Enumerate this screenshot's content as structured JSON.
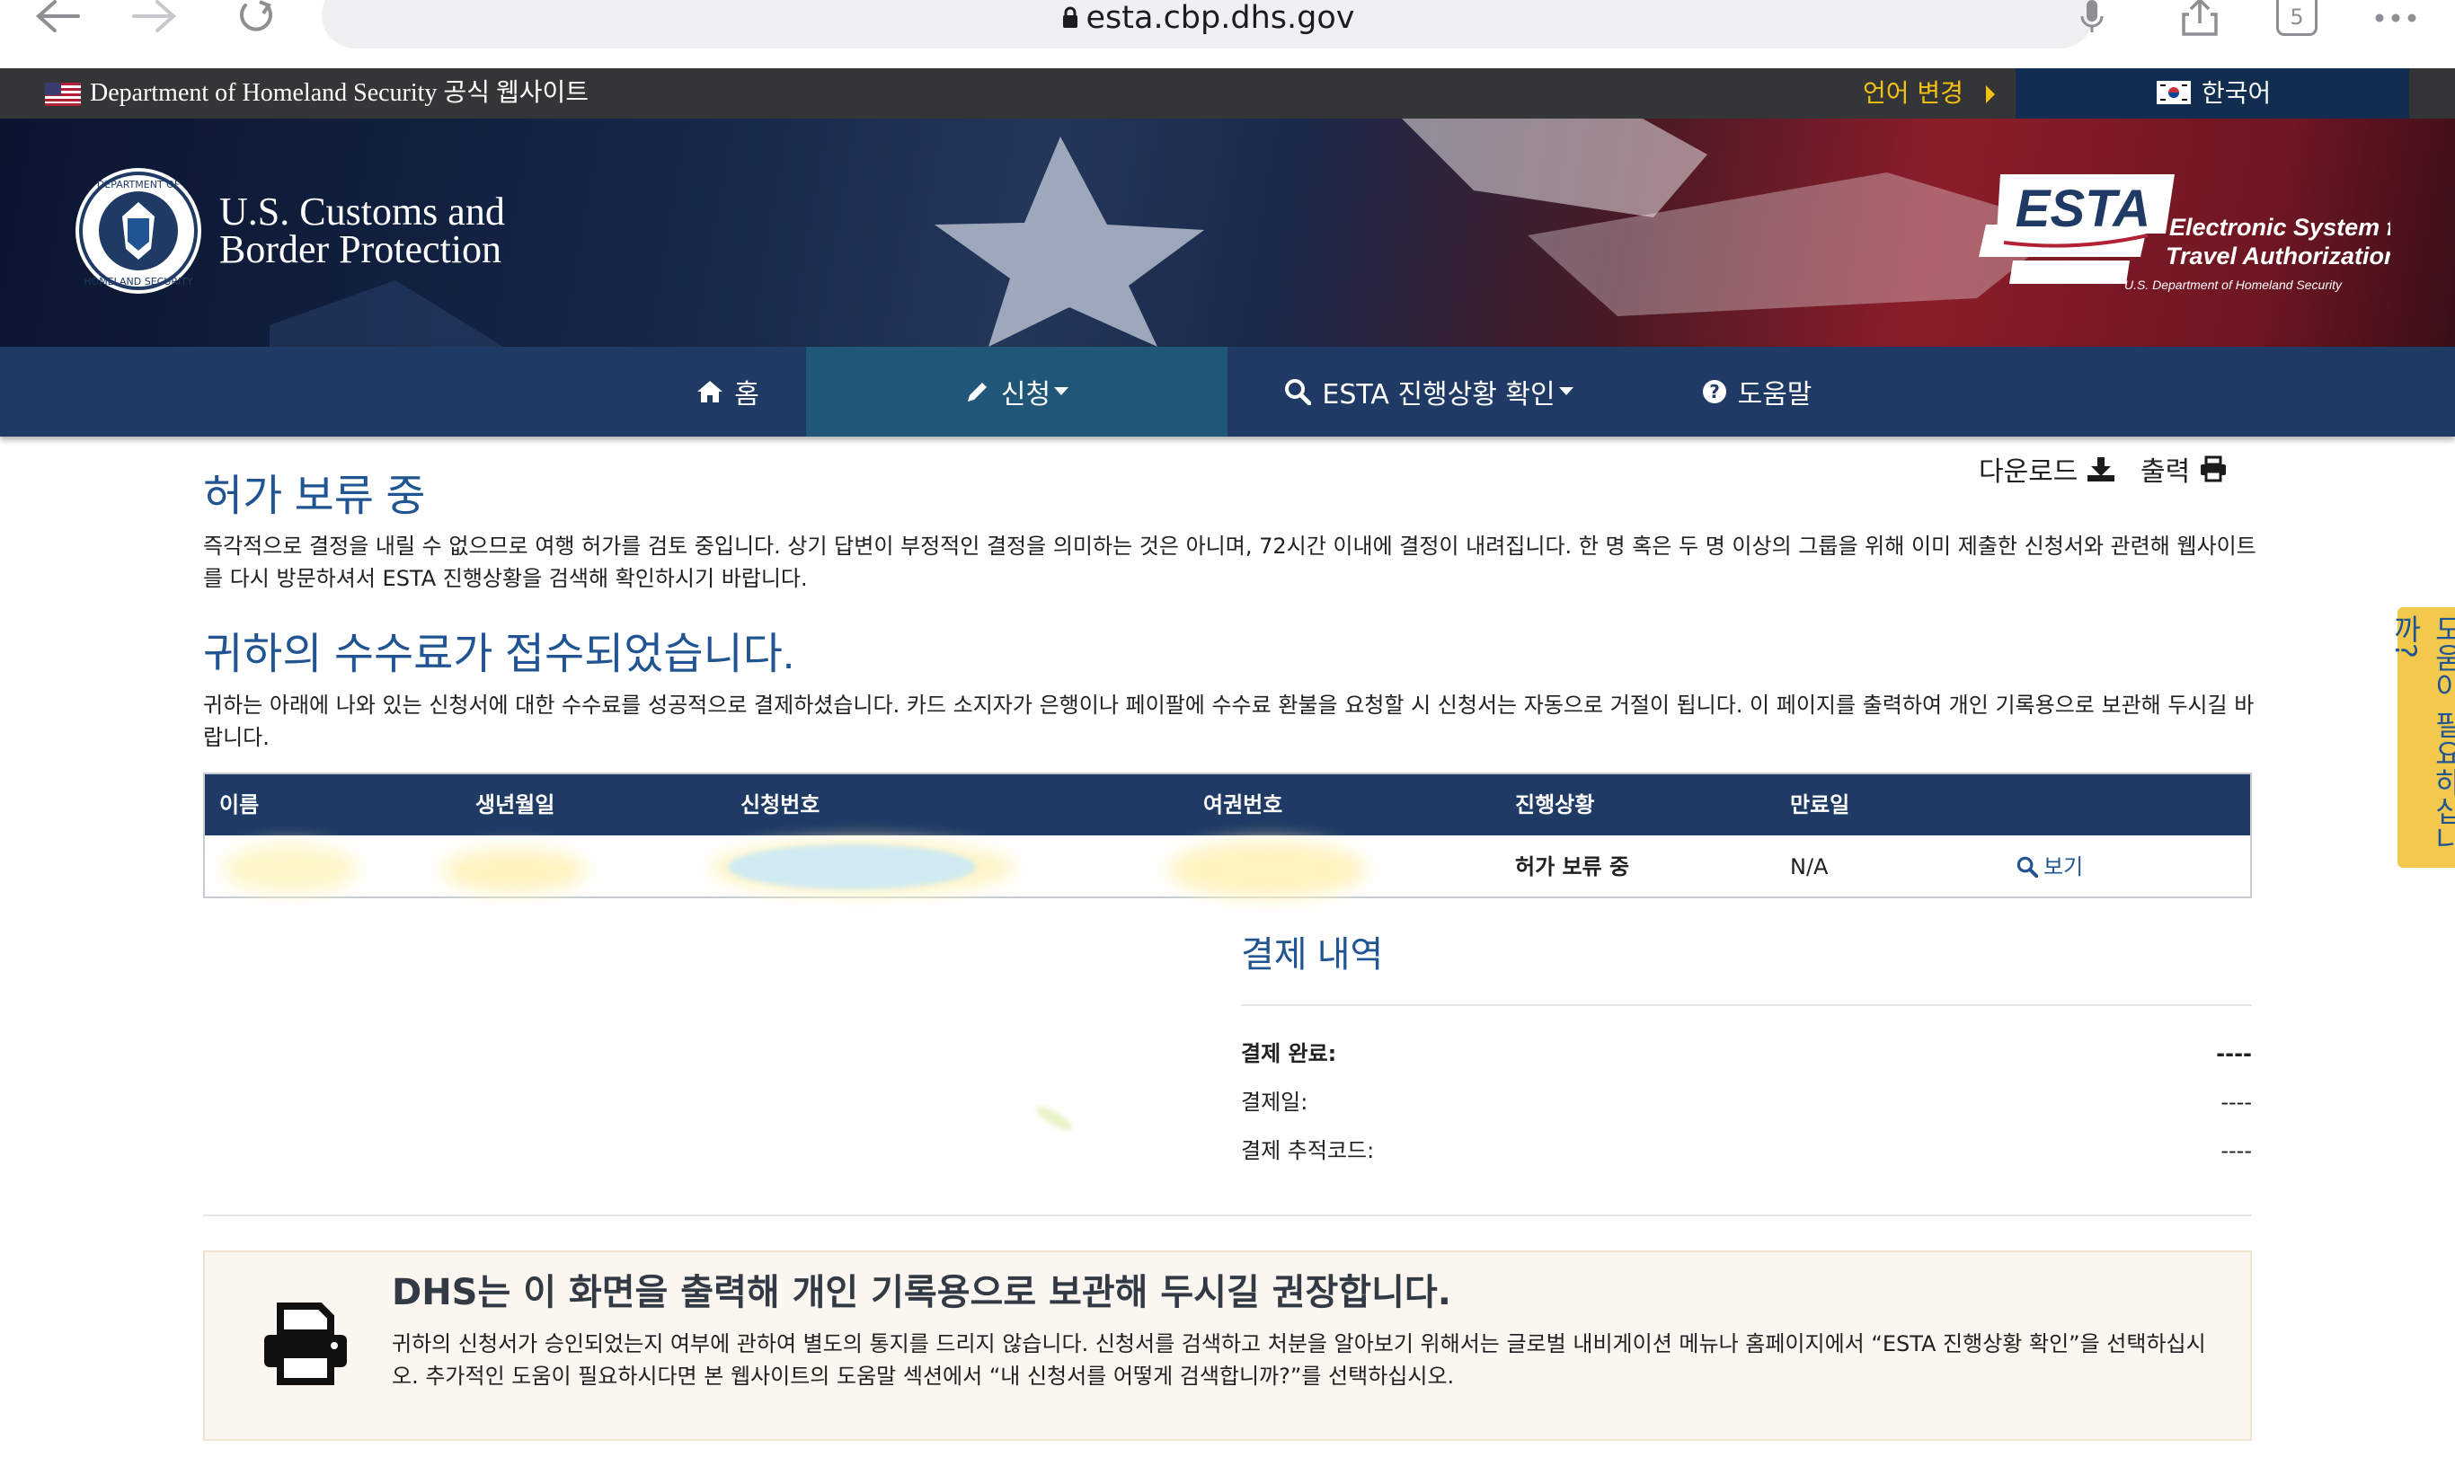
{
  "browser": {
    "url": "esta.cbp.dhs.gov",
    "tab_count": "5"
  },
  "gov_banner": {
    "text": "Department of Homeland Security 공식 웹사이트",
    "change_language": "언어 변경",
    "current_language": "한국어"
  },
  "header": {
    "agency_name": "U.S. Customs and\nBorder Protection",
    "esta_logo": "ESTA",
    "esta_full_name_1": "Electronic System for",
    "esta_full_name_2": "Travel Authorization",
    "esta_sub": "U.S. Department of Homeland Security"
  },
  "nav": {
    "home": "홈",
    "apply": "신청",
    "check_status": "ESTA 진행상황 확인",
    "help": "도움말"
  },
  "tools": {
    "download": "다운로드",
    "print": "출력"
  },
  "pending": {
    "title": "허가 보류 중",
    "body": "즉각적으로 결정을 내릴 수 없으므로 여행 허가를 검토 중입니다. 상기 답변이 부정적인 결정을 의미하는 것은 아니며, 72시간 이내에 결정이 내려집니다. 한 명 혹은 두 명 이상의 그룹을 위해 이미 제출한 신청서와 관련해 웹사이트를 다시 방문하셔서 ESTA 진행상황을 검색해 확인하시기 바랍니다."
  },
  "fee": {
    "title": "귀하의 수수료가 접수되었습니다.",
    "body": "귀하는 아래에 나와 있는 신청서에 대한 수수료를 성공적으로 결제하셨습니다. 카드 소지자가 은행이나 페이팔에 수수료 환불을 요청할 시 신청서는 자동으로 거절이 됩니다. 이 페이지를 출력하여 개인 기록용으로 보관해 두시길 바랍니다."
  },
  "table": {
    "headers": [
      "이름",
      "생년월일",
      "신청번호",
      "여권번호",
      "진행상황",
      "만료일"
    ],
    "row": {
      "status": "허가 보류 중",
      "expiry": "N/A",
      "view": "보기"
    }
  },
  "payment": {
    "title": "결제 내역",
    "rows": [
      {
        "label": "결제 완료:",
        "value": "----"
      },
      {
        "label": "결제일:",
        "value": "----"
      },
      {
        "label": "결제 추적코드:",
        "value": "----"
      }
    ]
  },
  "notice": {
    "title": "DHS는 이 화면을 출력해 개인 기록용으로 보관해 두시길 권장합니다.",
    "body": "귀하의 신청서가 승인되었는지 여부에 관하여 별도의 통지를 드리지 않습니다. 신청서를 검색하고 처분을 알아보기 위해서는 글로벌 내비게이션 메뉴나 홈페이지에서 “ESTA 진행상황 확인”을 선택하십시오. 추가적인 도움이 필요하시다면 본 웹사이트의 도움말 섹션에서 “내 신청서를 어떻게 검색합니까?”를 선택하십시오."
  },
  "help_tab": "도움이 필요하십니까?",
  "colors": {
    "navy": "#1f3a64",
    "active_nav": "#205677",
    "heading_blue": "#205493",
    "lang_gold": "#f3c013",
    "help_tab_yellow": "#f2c94c"
  }
}
